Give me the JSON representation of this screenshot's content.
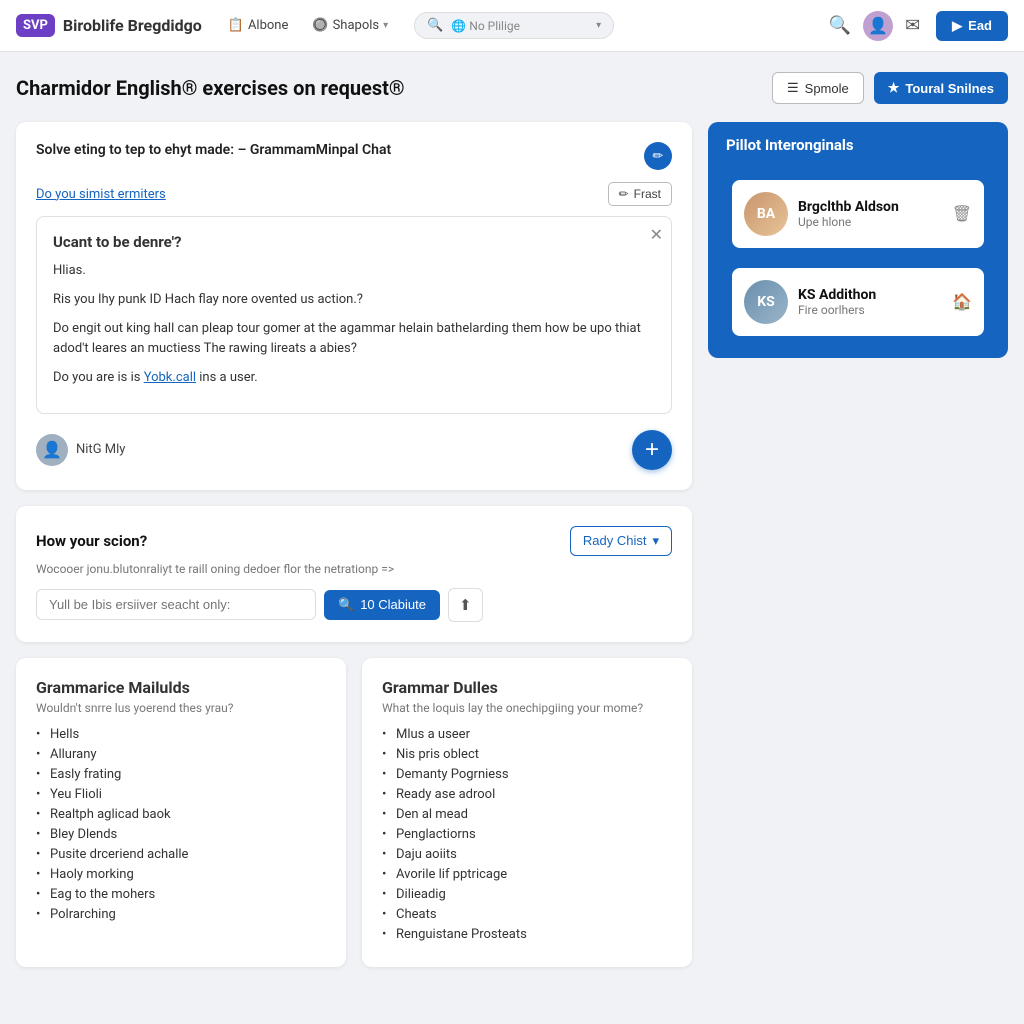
{
  "header": {
    "logo_badge": "SVP",
    "logo_text_part1": "Biroblife",
    "logo_text_part2": "Bregdidgo",
    "nav": [
      {
        "label": "Albone",
        "icon": "📋",
        "has_chevron": false
      },
      {
        "label": "Shapols",
        "icon": "🔘",
        "has_chevron": true
      }
    ],
    "search_placeholder": "No Plilige",
    "cta_label": "Ead",
    "cta_icon": "▶"
  },
  "page": {
    "title": "Charmidor English® exercises on request®",
    "btn_sample": "Spmole",
    "btn_tutorial": "Toural Snilnes"
  },
  "exercise_card": {
    "title": "Solve eting to tep to ehyt made: – GrammamMinpal Chat",
    "do_you_text": "Do you simist ermiters",
    "frast_label": "Frast",
    "content": {
      "heading": "Ucant to be denre'?",
      "line1": "Hlias.",
      "line2": "Ris you Ihy punk ID Hach flay nore ovented us action.?",
      "line3": "Do engit out king hall can pleap tour gomer at the agammar helain bathelarding them how be upo thiat adod't leares an muctiess The rawing lireats a abies?",
      "line4_prefix": "Do you are is is ",
      "line4_link": "Yobk.call",
      "line4_suffix": " ins a user."
    },
    "user_name": "NitG Mly",
    "add_label": "+"
  },
  "section_card": {
    "title": "How your scion?",
    "desc": "Wocooer jonu.blutonraliyt te raill oning dedoer flor the netrationp =>",
    "badge_label": "Rady Chist",
    "input_placeholder": "Yull be Ibis ersiiver seacht only:",
    "search_btn": "10 Clabiute",
    "search_count": "10"
  },
  "bottom_cards": [
    {
      "title": "Grammarice Mailulds",
      "desc": "Wouldn't snrre lus yoerend thes yrau?",
      "items": [
        "Hells",
        "Allurany",
        "Easly frating",
        "Yeu Flioli",
        "Realtph aglicad baok",
        "Bley Dlends",
        "Pusite drceriend achalle",
        "Haoly morking",
        "Eag to the mohers",
        "Polrarching"
      ]
    },
    {
      "title": "Grammar Dulles",
      "desc": "What the loquis lay the onechipgiing your mome?",
      "items": [
        "Mlus a useer",
        "Nis pris oblect",
        "Demanty Pogrniess",
        "Ready ase adrool",
        "Den al mead",
        "Penglactiorns",
        "Daju aoiits",
        "Avorile lif pptricage",
        "Dilieadig",
        "Cheats",
        "Renguistane Prosteats"
      ]
    }
  ],
  "sidebar_panel": {
    "header": "Pillot Interonginals",
    "persons": [
      {
        "name": "Brgclthb Aldson",
        "role": "Upe hlone",
        "action_icon": "🗑",
        "avatar_initials": "BA",
        "avatar_class": "avatar-1"
      },
      {
        "name": "KS Addithon",
        "role": "Fire oorlhers",
        "action_icon": "🏠",
        "avatar_initials": "KS",
        "avatar_class": "avatar-2"
      }
    ]
  }
}
